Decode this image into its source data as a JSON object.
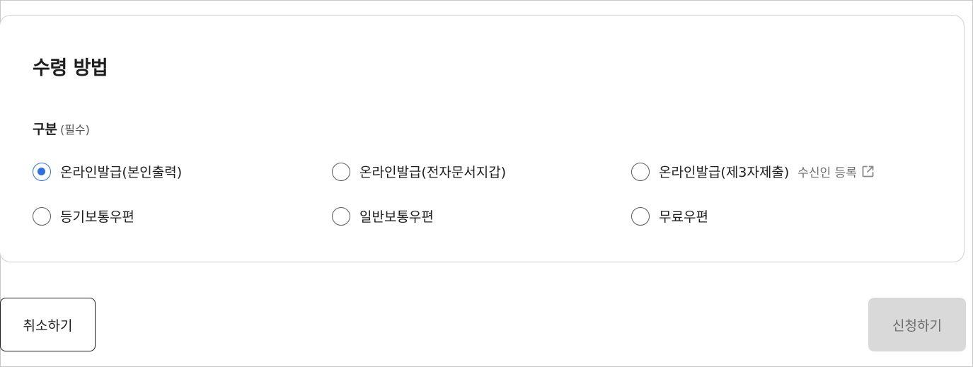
{
  "section": {
    "title": "수령 방법",
    "field_label": "구분",
    "required_text": "(필수)"
  },
  "options": [
    {
      "label": "온라인발급(본인출력)",
      "checked": true
    },
    {
      "label": "온라인발급(전자문서지갑)",
      "checked": false
    },
    {
      "label": "온라인발급(제3자제출)",
      "checked": false,
      "extra_link": "수신인 등록",
      "extra_icon": "external-link-icon"
    },
    {
      "label": "등기보통우편",
      "checked": false
    },
    {
      "label": "일반보통우편",
      "checked": false
    },
    {
      "label": "무료우편",
      "checked": false
    }
  ],
  "buttons": {
    "cancel": "취소하기",
    "submit": "신청하기"
  },
  "colors": {
    "accent": "#2f6fdf",
    "disabled_bg": "#d9d9d9",
    "disabled_text": "#6e6e6e",
    "border": "#d2d2d2"
  }
}
